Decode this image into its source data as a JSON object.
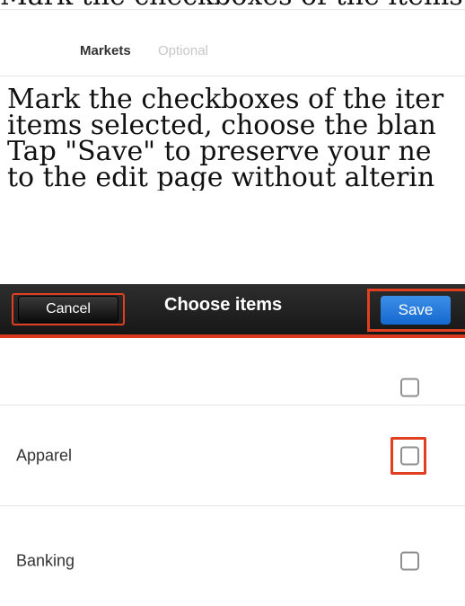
{
  "top_fragment": "Mark the checkboxes of the items",
  "field": {
    "label": "Markets",
    "hint": "Optional"
  },
  "instructions": [
    "Mark the checkboxes of the iter",
    "items selected, choose the blan",
    "Tap \"Save\" to preserve your ne",
    "to the edit page without alterin"
  ],
  "nav": {
    "cancel_label": "Cancel",
    "title": "Choose items",
    "save_label": "Save"
  },
  "items": [
    {
      "label": "",
      "checked": false
    },
    {
      "label": "Apparel",
      "checked": false
    },
    {
      "label": "Banking",
      "checked": false
    }
  ],
  "colors": {
    "highlight": "#e0401f",
    "nav_bg": "#1e1e1e",
    "save_blue": "#1f74dd"
  }
}
